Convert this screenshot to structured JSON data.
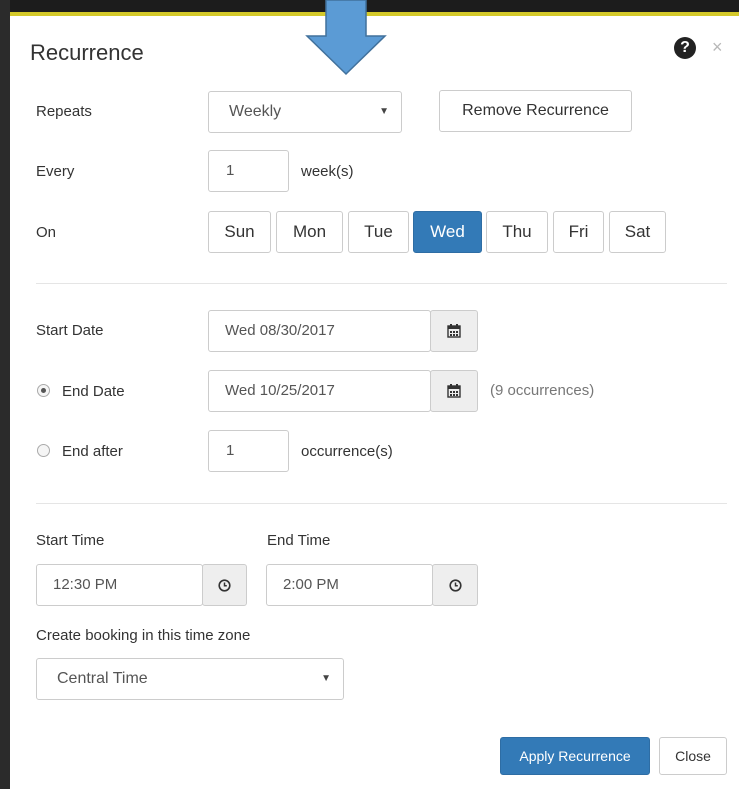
{
  "modal": {
    "title": "Recurrence",
    "help_icon": "question-circle-icon",
    "close_glyph": "×"
  },
  "repeats": {
    "label": "Repeats",
    "value": "Weekly",
    "remove_label": "Remove Recurrence"
  },
  "every": {
    "label": "Every",
    "value": "1",
    "unit": "week(s)"
  },
  "on": {
    "label": "On",
    "days": [
      "Sun",
      "Mon",
      "Tue",
      "Wed",
      "Thu",
      "Fri",
      "Sat"
    ],
    "selected": "Wed"
  },
  "dates": {
    "start_label": "Start Date",
    "start_value": "Wed 08/30/2017",
    "end_label": "End Date",
    "end_value": "Wed 10/25/2017",
    "end_occurrences": "(9 occurrences)",
    "end_after_label": "End after",
    "end_after_value": "1",
    "end_after_unit": "occurrence(s)",
    "end_mode": "End Date"
  },
  "times": {
    "start_label": "Start Time",
    "start_value": "12:30 PM",
    "end_label": "End Time",
    "end_value": "2:00 PM",
    "timezone_label": "Create booking in this time zone",
    "timezone_value": "Central Time"
  },
  "footer": {
    "apply_label": "Apply Recurrence",
    "close_label": "Close"
  },
  "colors": {
    "primary": "#337ab7",
    "annotation_arrow": "#5b9bd5"
  }
}
